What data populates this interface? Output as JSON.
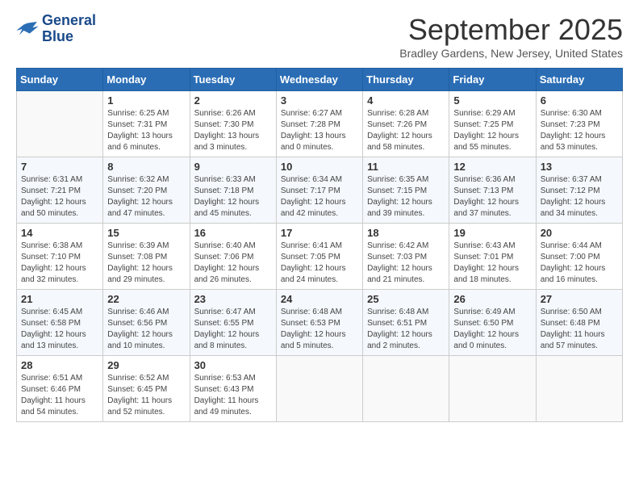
{
  "header": {
    "logo_line1": "General",
    "logo_line2": "Blue",
    "month": "September 2025",
    "location": "Bradley Gardens, New Jersey, United States"
  },
  "weekdays": [
    "Sunday",
    "Monday",
    "Tuesday",
    "Wednesday",
    "Thursday",
    "Friday",
    "Saturday"
  ],
  "weeks": [
    [
      {
        "day": "",
        "detail": ""
      },
      {
        "day": "1",
        "detail": "Sunrise: 6:25 AM\nSunset: 7:31 PM\nDaylight: 13 hours\nand 6 minutes."
      },
      {
        "day": "2",
        "detail": "Sunrise: 6:26 AM\nSunset: 7:30 PM\nDaylight: 13 hours\nand 3 minutes."
      },
      {
        "day": "3",
        "detail": "Sunrise: 6:27 AM\nSunset: 7:28 PM\nDaylight: 13 hours\nand 0 minutes."
      },
      {
        "day": "4",
        "detail": "Sunrise: 6:28 AM\nSunset: 7:26 PM\nDaylight: 12 hours\nand 58 minutes."
      },
      {
        "day": "5",
        "detail": "Sunrise: 6:29 AM\nSunset: 7:25 PM\nDaylight: 12 hours\nand 55 minutes."
      },
      {
        "day": "6",
        "detail": "Sunrise: 6:30 AM\nSunset: 7:23 PM\nDaylight: 12 hours\nand 53 minutes."
      }
    ],
    [
      {
        "day": "7",
        "detail": "Sunrise: 6:31 AM\nSunset: 7:21 PM\nDaylight: 12 hours\nand 50 minutes."
      },
      {
        "day": "8",
        "detail": "Sunrise: 6:32 AM\nSunset: 7:20 PM\nDaylight: 12 hours\nand 47 minutes."
      },
      {
        "day": "9",
        "detail": "Sunrise: 6:33 AM\nSunset: 7:18 PM\nDaylight: 12 hours\nand 45 minutes."
      },
      {
        "day": "10",
        "detail": "Sunrise: 6:34 AM\nSunset: 7:17 PM\nDaylight: 12 hours\nand 42 minutes."
      },
      {
        "day": "11",
        "detail": "Sunrise: 6:35 AM\nSunset: 7:15 PM\nDaylight: 12 hours\nand 39 minutes."
      },
      {
        "day": "12",
        "detail": "Sunrise: 6:36 AM\nSunset: 7:13 PM\nDaylight: 12 hours\nand 37 minutes."
      },
      {
        "day": "13",
        "detail": "Sunrise: 6:37 AM\nSunset: 7:12 PM\nDaylight: 12 hours\nand 34 minutes."
      }
    ],
    [
      {
        "day": "14",
        "detail": "Sunrise: 6:38 AM\nSunset: 7:10 PM\nDaylight: 12 hours\nand 32 minutes."
      },
      {
        "day": "15",
        "detail": "Sunrise: 6:39 AM\nSunset: 7:08 PM\nDaylight: 12 hours\nand 29 minutes."
      },
      {
        "day": "16",
        "detail": "Sunrise: 6:40 AM\nSunset: 7:06 PM\nDaylight: 12 hours\nand 26 minutes."
      },
      {
        "day": "17",
        "detail": "Sunrise: 6:41 AM\nSunset: 7:05 PM\nDaylight: 12 hours\nand 24 minutes."
      },
      {
        "day": "18",
        "detail": "Sunrise: 6:42 AM\nSunset: 7:03 PM\nDaylight: 12 hours\nand 21 minutes."
      },
      {
        "day": "19",
        "detail": "Sunrise: 6:43 AM\nSunset: 7:01 PM\nDaylight: 12 hours\nand 18 minutes."
      },
      {
        "day": "20",
        "detail": "Sunrise: 6:44 AM\nSunset: 7:00 PM\nDaylight: 12 hours\nand 16 minutes."
      }
    ],
    [
      {
        "day": "21",
        "detail": "Sunrise: 6:45 AM\nSunset: 6:58 PM\nDaylight: 12 hours\nand 13 minutes."
      },
      {
        "day": "22",
        "detail": "Sunrise: 6:46 AM\nSunset: 6:56 PM\nDaylight: 12 hours\nand 10 minutes."
      },
      {
        "day": "23",
        "detail": "Sunrise: 6:47 AM\nSunset: 6:55 PM\nDaylight: 12 hours\nand 8 minutes."
      },
      {
        "day": "24",
        "detail": "Sunrise: 6:48 AM\nSunset: 6:53 PM\nDaylight: 12 hours\nand 5 minutes."
      },
      {
        "day": "25",
        "detail": "Sunrise: 6:48 AM\nSunset: 6:51 PM\nDaylight: 12 hours\nand 2 minutes."
      },
      {
        "day": "26",
        "detail": "Sunrise: 6:49 AM\nSunset: 6:50 PM\nDaylight: 12 hours\nand 0 minutes."
      },
      {
        "day": "27",
        "detail": "Sunrise: 6:50 AM\nSunset: 6:48 PM\nDaylight: 11 hours\nand 57 minutes."
      }
    ],
    [
      {
        "day": "28",
        "detail": "Sunrise: 6:51 AM\nSunset: 6:46 PM\nDaylight: 11 hours\nand 54 minutes."
      },
      {
        "day": "29",
        "detail": "Sunrise: 6:52 AM\nSunset: 6:45 PM\nDaylight: 11 hours\nand 52 minutes."
      },
      {
        "day": "30",
        "detail": "Sunrise: 6:53 AM\nSunset: 6:43 PM\nDaylight: 11 hours\nand 49 minutes."
      },
      {
        "day": "",
        "detail": ""
      },
      {
        "day": "",
        "detail": ""
      },
      {
        "day": "",
        "detail": ""
      },
      {
        "day": "",
        "detail": ""
      }
    ]
  ]
}
